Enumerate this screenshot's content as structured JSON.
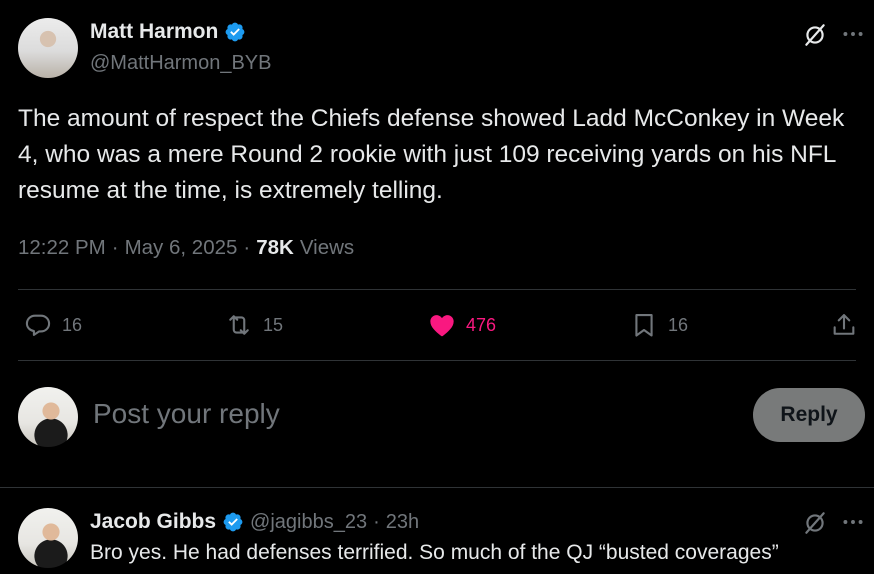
{
  "tweet": {
    "author_name": "Matt Harmon",
    "author_handle": "@MattHarmon_BYB",
    "text": "The amount of respect the Chiefs defense showed Ladd McConkey in Week 4, who was a mere Round 2 rookie with just 109 receiving yards on his NFL resume at the time, is extremely telling.",
    "time": "12:22 PM",
    "date": "May 6, 2025",
    "views_count": "78K",
    "views_label": "Views",
    "separator": "·"
  },
  "actions": {
    "replies": "16",
    "reposts": "15",
    "likes": "476",
    "bookmarks": "16"
  },
  "composer": {
    "placeholder": "Post your reply",
    "button_label": "Reply"
  },
  "reply": {
    "author_name": "Jacob Gibbs",
    "author_handle": "@jagibbs_23",
    "time": "23h",
    "separator": "·",
    "text": "Bro yes. He had defenses terrified. So much of the QJ “busted coverages”"
  },
  "colors": {
    "background": "#000000",
    "text": "#e7e9ea",
    "muted": "#71767b",
    "verified": "#1d9bf0",
    "like": "#f91880",
    "divider": "#2f3336"
  },
  "icons": {
    "verified": "verified-badge-icon",
    "grok": "grok-icon",
    "more": "more-icon",
    "reply": "reply-icon",
    "repost": "repost-icon",
    "like": "heart-icon",
    "bookmark": "bookmark-icon",
    "share": "share-icon"
  }
}
